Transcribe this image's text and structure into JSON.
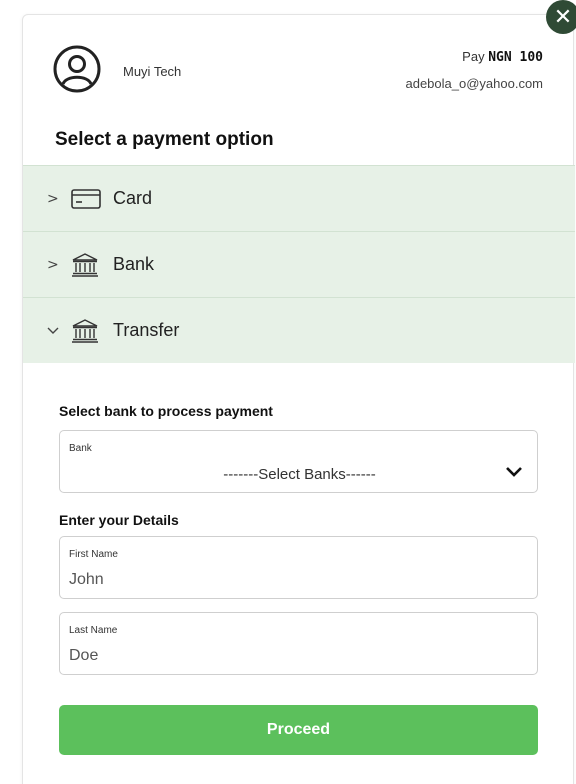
{
  "header": {
    "merchant_name": "Muyi Tech",
    "pay_prefix": "Pay",
    "pay_amount": "NGN 100",
    "email": "adebola_o@yahoo.com",
    "title": "Select a payment option"
  },
  "options": [
    {
      "label": "Card",
      "chevron": ">",
      "icon": "card-icon"
    },
    {
      "label": "Bank",
      "chevron": ">",
      "icon": "bank-icon"
    },
    {
      "label": "Transfer",
      "chevron": "v",
      "icon": "bank-icon"
    }
  ],
  "transfer": {
    "select_bank_label": "Select bank to process payment",
    "bank_field_label": "Bank",
    "bank_selected": "-------Select Banks------",
    "details_label": "Enter your Details",
    "first_name_label": "First Name",
    "first_name_value": "John",
    "last_name_label": "Last Name",
    "last_name_value": "Doe",
    "proceed_label": "Proceed"
  },
  "colors": {
    "accent": "#5cc05c",
    "option_bg": "#e7f1e7",
    "close_bg": "#2f4a35"
  }
}
